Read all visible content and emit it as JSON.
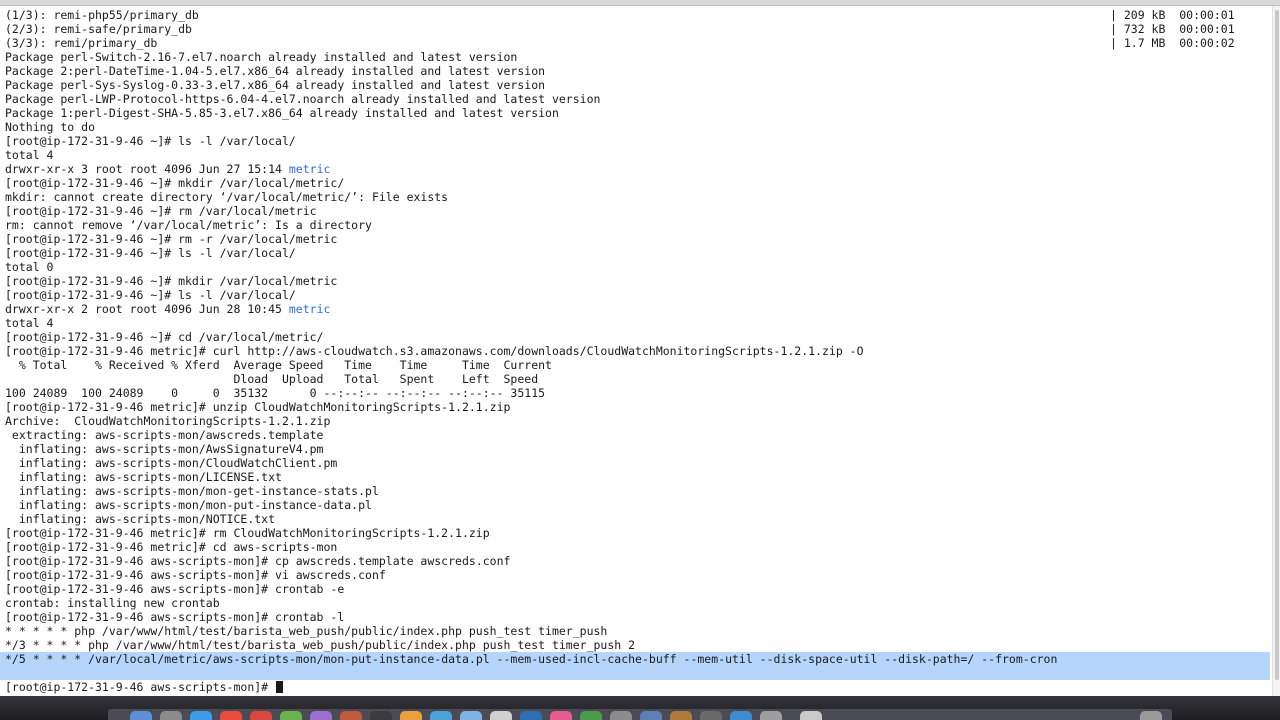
{
  "terminal": {
    "lines": [
      "(1/3): remi-php55/primary_db",
      "(2/3): remi-safe/primary_db",
      "(3/3): remi/primary_db",
      "Package perl-Switch-2.16-7.el7.noarch already installed and latest version",
      "Package 2:perl-DateTime-1.04-5.el7.x86_64 already installed and latest version",
      "Package perl-Sys-Syslog-0.33-3.el7.x86_64 already installed and latest version",
      "Package perl-LWP-Protocol-https-6.04-4.el7.noarch already installed and latest version",
      "Package 1:perl-Digest-SHA-5.85-3.el7.x86_64 already installed and latest version",
      "Nothing to do",
      "[root@ip-172-31-9-46 ~]# ls -l /var/local/",
      "total 4",
      "drwxr-xr-x 3 root root 4096 Jun 27 15:14 ",
      "[root@ip-172-31-9-46 ~]# mkdir /var/local/metric/",
      "mkdir: cannot create directory ‘/var/local/metric/’: File exists",
      "[root@ip-172-31-9-46 ~]# rm /var/local/metric",
      "rm: cannot remove ‘/var/local/metric’: Is a directory",
      "[root@ip-172-31-9-46 ~]# rm -r /var/local/metric",
      "[root@ip-172-31-9-46 ~]# ls -l /var/local/",
      "total 0",
      "[root@ip-172-31-9-46 ~]# mkdir /var/local/metric",
      "[root@ip-172-31-9-46 ~]# ls -l /var/local/",
      "drwxr-xr-x 2 root root 4096 Jun 28 10:45 ",
      "total 4",
      "[root@ip-172-31-9-46 ~]# cd /var/local/metric/",
      "[root@ip-172-31-9-46 metric]# curl http://aws-cloudwatch.s3.amazonaws.com/downloads/CloudWatchMonitoringScripts-1.2.1.zip -O",
      "  % Total    % Received % Xferd  Average Speed   Time    Time     Time  Current",
      "                                 Dload  Upload   Total   Spent    Left  Speed",
      "100 24089  100 24089    0     0  35132      0 --:--:-- --:--:-- --:--:-- 35115",
      "[root@ip-172-31-9-46 metric]# unzip CloudWatchMonitoringScripts-1.2.1.zip",
      "Archive:  CloudWatchMonitoringScripts-1.2.1.zip",
      " extracting: aws-scripts-mon/awscreds.template",
      "  inflating: aws-scripts-mon/AwsSignatureV4.pm",
      "  inflating: aws-scripts-mon/CloudWatchClient.pm",
      "  inflating: aws-scripts-mon/LICENSE.txt",
      "  inflating: aws-scripts-mon/mon-get-instance-stats.pl",
      "  inflating: aws-scripts-mon/mon-put-instance-data.pl",
      "  inflating: aws-scripts-mon/NOTICE.txt",
      "[root@ip-172-31-9-46 metric]# rm CloudWatchMonitoringScripts-1.2.1.zip",
      "[root@ip-172-31-9-46 metric]# cd aws-scripts-mon",
      "[root@ip-172-31-9-46 aws-scripts-mon]# cp awscreds.template awscreds.conf",
      "[root@ip-172-31-9-46 aws-scripts-mon]# vi awscreds.conf",
      "[root@ip-172-31-9-46 aws-scripts-mon]# crontab -e",
      "crontab: installing new crontab",
      "[root@ip-172-31-9-46 aws-scripts-mon]# crontab -l",
      "* * * * * php /var/www/html/test/barista_web_push/public/index.php push_test timer_push",
      "*/3 * * * * php /var/www/html/test/barista_web_push/public/index.php push_test timer_push 2"
    ],
    "highlight_word": "metric",
    "selected_line": {
      "prefix": "*/5 * * * * ",
      "selected": "/var/local/metric/aws-scripts-mon/mon-put-instance-data.pl --mem-used-incl-cache-buff --mem-util --disk-space-util --disk-path=/ --from-cron"
    },
    "prompt": "[root@ip-172-31-9-46 aws-scripts-mon]# ",
    "download_stats": [
      "| 209 kB  00:00:01",
      "| 732 kB  00:00:01",
      "| 1.7 MB  00:00:02"
    ]
  },
  "colors": {
    "text": "#1a1a1a",
    "link": "#2f6bdc",
    "selection": "#b5d5fb",
    "background": "#ffffff"
  }
}
